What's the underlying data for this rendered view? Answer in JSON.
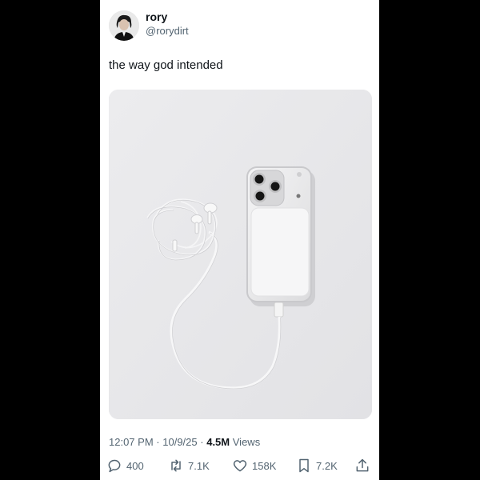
{
  "author": {
    "name": "rory",
    "handle": "@rorydirt"
  },
  "tweet": {
    "text": "the way god intended"
  },
  "meta": {
    "time": "12:07 PM",
    "sep1": "·",
    "date": "10/9/25",
    "sep2": "·",
    "views_count": "4.5M",
    "views_label": "Views"
  },
  "actions": {
    "replies": "400",
    "reposts": "7.1K",
    "likes": "158K",
    "bookmarks": "7.2K"
  },
  "icons": [
    "reply-icon",
    "repost-icon",
    "like-icon",
    "bookmark-icon",
    "share-icon"
  ],
  "colors": {
    "text": "#0f1419",
    "secondary": "#536471",
    "background": "#ffffff",
    "letterbox": "#000000"
  }
}
